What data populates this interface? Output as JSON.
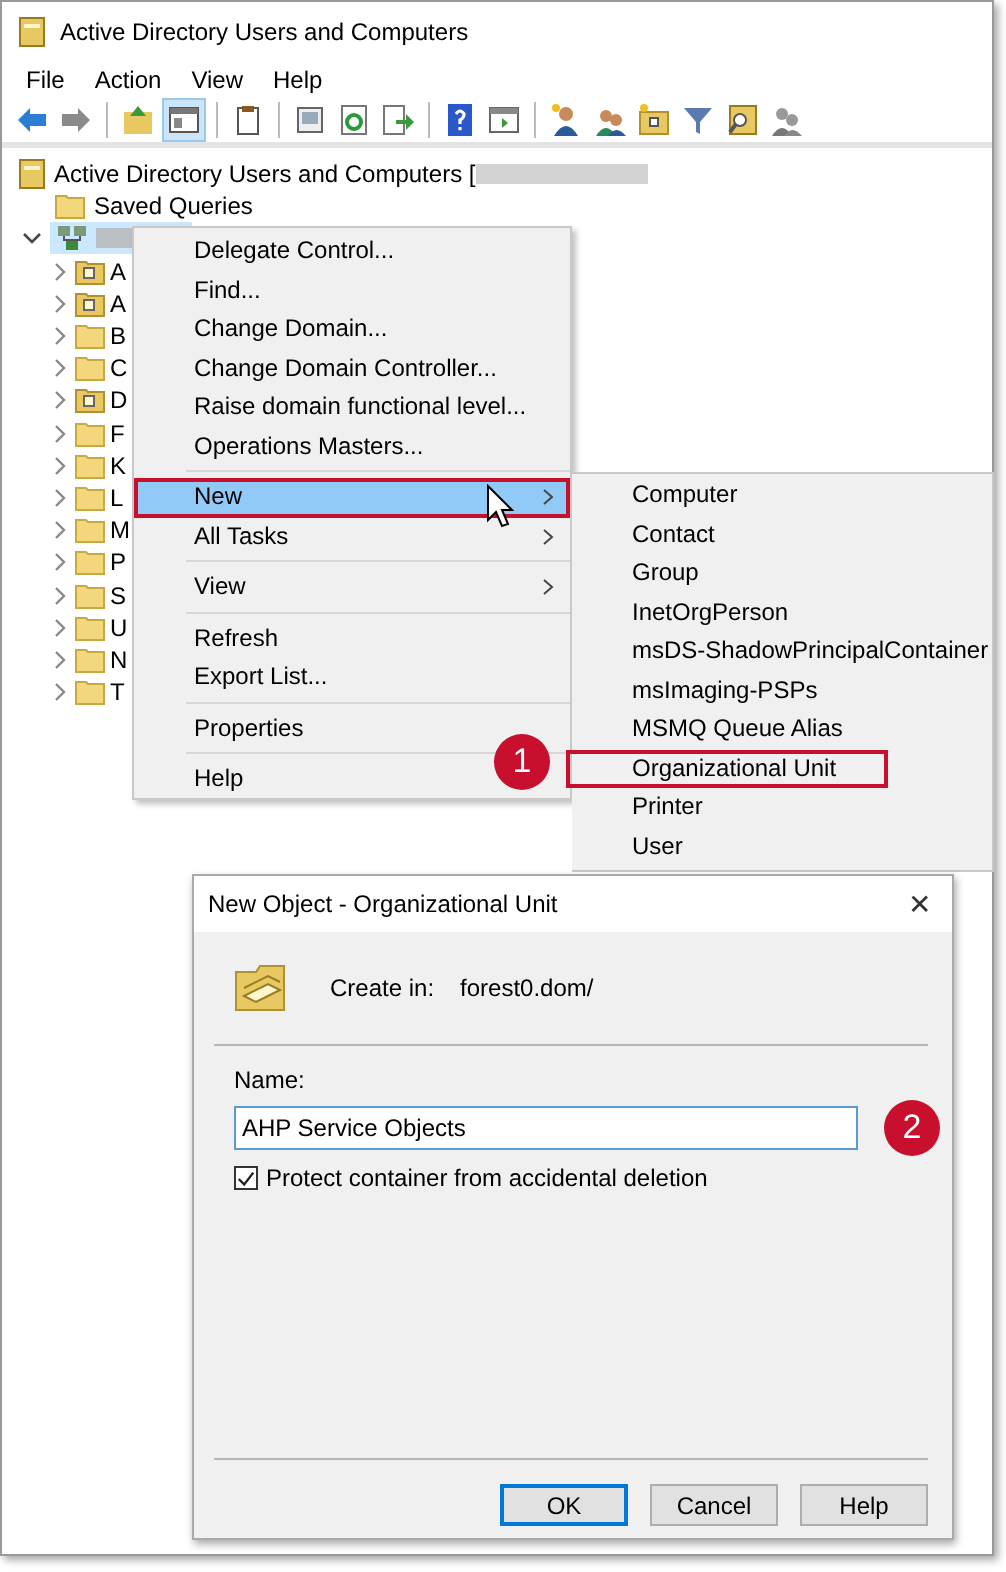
{
  "window": {
    "title": "Active Directory Users and Computers"
  },
  "menu_bar": [
    "File",
    "Action",
    "View",
    "Help"
  ],
  "tree": {
    "root": "Active Directory Users and Computers [",
    "saved_queries": "Saved Queries",
    "domain": {
      "expanded": true,
      "selected": true,
      "children": [
        {
          "label": "A",
          "kind": "ou",
          "expanded": false
        },
        {
          "label": "A",
          "kind": "ou",
          "expanded": false
        },
        {
          "label": "B",
          "kind": "folder",
          "expanded": false
        },
        {
          "label": "C",
          "kind": "folder",
          "expanded": false
        },
        {
          "label": "D",
          "kind": "ou",
          "expanded": false
        },
        {
          "label": "F",
          "kind": "folder",
          "expanded": false
        },
        {
          "label": "K",
          "kind": "folder",
          "expanded": false
        },
        {
          "label": "L",
          "kind": "folder",
          "expanded": false
        },
        {
          "label": "M",
          "kind": "folder",
          "expanded": false
        },
        {
          "label": "P",
          "kind": "folder",
          "expanded": false
        },
        {
          "label": "S",
          "kind": "folder",
          "expanded": false
        },
        {
          "label": "U",
          "kind": "folder",
          "expanded": false
        },
        {
          "label": "N",
          "kind": "folder",
          "expanded": false
        },
        {
          "label": "T",
          "kind": "folder",
          "expanded": false
        }
      ]
    }
  },
  "context_menu": {
    "badge": "1",
    "groups": [
      [
        {
          "label": "Delegate Control...",
          "selected": false,
          "submenu": false,
          "callout": false
        },
        {
          "label": "Find...",
          "selected": false,
          "submenu": false,
          "callout": false
        },
        {
          "label": "Change Domain...",
          "selected": false,
          "submenu": false,
          "callout": false
        },
        {
          "label": "Change Domain Controller...",
          "selected": false,
          "submenu": false,
          "callout": false
        },
        {
          "label": "Raise domain functional level...",
          "selected": false,
          "submenu": false,
          "callout": false
        },
        {
          "label": "Operations Masters...",
          "selected": false,
          "submenu": false,
          "callout": false
        }
      ],
      [
        {
          "label": "New",
          "selected": true,
          "submenu": true,
          "callout": true
        },
        {
          "label": "All Tasks",
          "selected": false,
          "submenu": true,
          "callout": false
        }
      ],
      [
        {
          "label": "View",
          "selected": false,
          "submenu": true,
          "callout": false
        }
      ],
      [
        {
          "label": "Refresh",
          "selected": false,
          "submenu": false,
          "callout": false
        },
        {
          "label": "Export List...",
          "selected": false,
          "submenu": false,
          "callout": false
        }
      ],
      [
        {
          "label": "Properties",
          "selected": false,
          "submenu": false,
          "callout": false
        }
      ],
      [
        {
          "label": "Help",
          "selected": false,
          "submenu": false,
          "callout": false
        }
      ]
    ]
  },
  "submenu": {
    "items": [
      {
        "label": "Computer",
        "callout": false
      },
      {
        "label": "Contact",
        "callout": false
      },
      {
        "label": "Group",
        "callout": false
      },
      {
        "label": "InetOrgPerson",
        "callout": false
      },
      {
        "label": "msDS-ShadowPrincipalContainer",
        "callout": false
      },
      {
        "label": "msImaging-PSPs",
        "callout": false
      },
      {
        "label": "MSMQ Queue Alias",
        "callout": false
      },
      {
        "label": "Organizational Unit",
        "callout": true
      },
      {
        "label": "Printer",
        "callout": false
      },
      {
        "label": "User",
        "callout": false
      }
    ]
  },
  "dialog": {
    "title": "New Object - Organizational Unit",
    "close": "✕",
    "badge": "2",
    "create_in_label": "Create in:",
    "create_in_value": "forest0.dom/",
    "name_label": "Name:",
    "name_value": "AHP Service Objects",
    "checkbox": {
      "label": "Protect container from accidental deletion",
      "checked": true
    },
    "buttons": [
      {
        "label": "OK",
        "default": true
      },
      {
        "label": "Cancel",
        "default": false
      },
      {
        "label": "Help",
        "default": false
      }
    ]
  }
}
